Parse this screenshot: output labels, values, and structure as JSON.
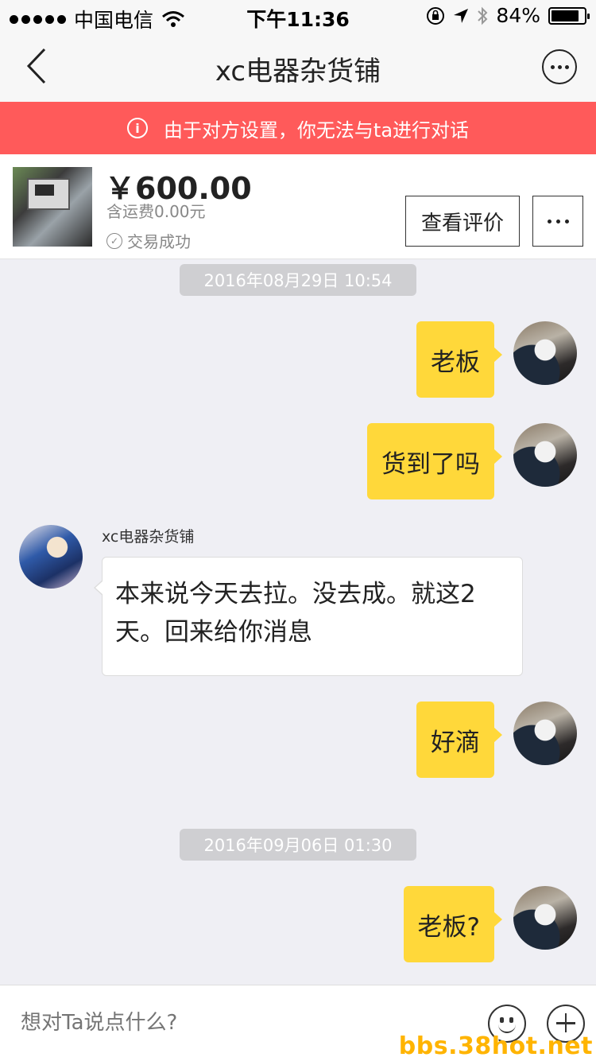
{
  "status_bar": {
    "carrier": "中国电信",
    "time": "下午11:36",
    "battery_text": "84%",
    "battery_level": 0.84
  },
  "nav": {
    "title": "xc电器杂货铺"
  },
  "banner": {
    "icon": "i",
    "text": "由于对方设置，你无法与ta进行对话"
  },
  "product": {
    "price": "￥600.00",
    "shipping": "含运费0.00元",
    "status_icon": "✓",
    "status": "交易成功",
    "review_button": "查看评价"
  },
  "messages": {
    "time1": "2016年08月29日 10:54",
    "m1": "老板",
    "m2": "货到了吗",
    "sender": "xc电器杂货铺",
    "m3": "本来说今天去拉。没去成。就这2天。回来给你消息",
    "m4": "好滴",
    "time2": "2016年09月06日 01:30",
    "m5": "老板?"
  },
  "input": {
    "placeholder": "想对Ta说点什么?"
  },
  "watermark": "bbs.38hot.net",
  "colors": {
    "banner": "#ff5a5a",
    "my_bubble": "#ffd83a"
  }
}
